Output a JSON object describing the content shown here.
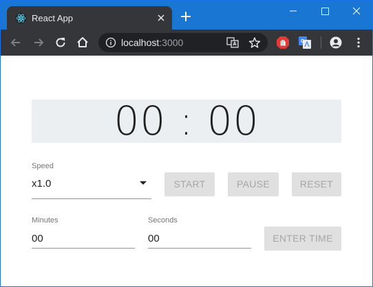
{
  "browser": {
    "tab_title": "React App",
    "url_host": "localhost",
    "url_port": ":3000"
  },
  "colors": {
    "title_bar": "#1976d2",
    "toolbar": "#35363a",
    "timer_bg": "#eceff1",
    "button_bg": "#e0e0e0",
    "button_text": "#a6a6a6"
  },
  "timer": {
    "display": "00 : 00"
  },
  "speed": {
    "label": "Speed",
    "value": "x1.0"
  },
  "buttons": {
    "start": "START",
    "pause": "PAUSE",
    "reset": "RESET",
    "enter_time": "ENTER TIME"
  },
  "minutes": {
    "label": "Minutes",
    "value": "00"
  },
  "seconds": {
    "label": "Seconds",
    "value": "00"
  }
}
